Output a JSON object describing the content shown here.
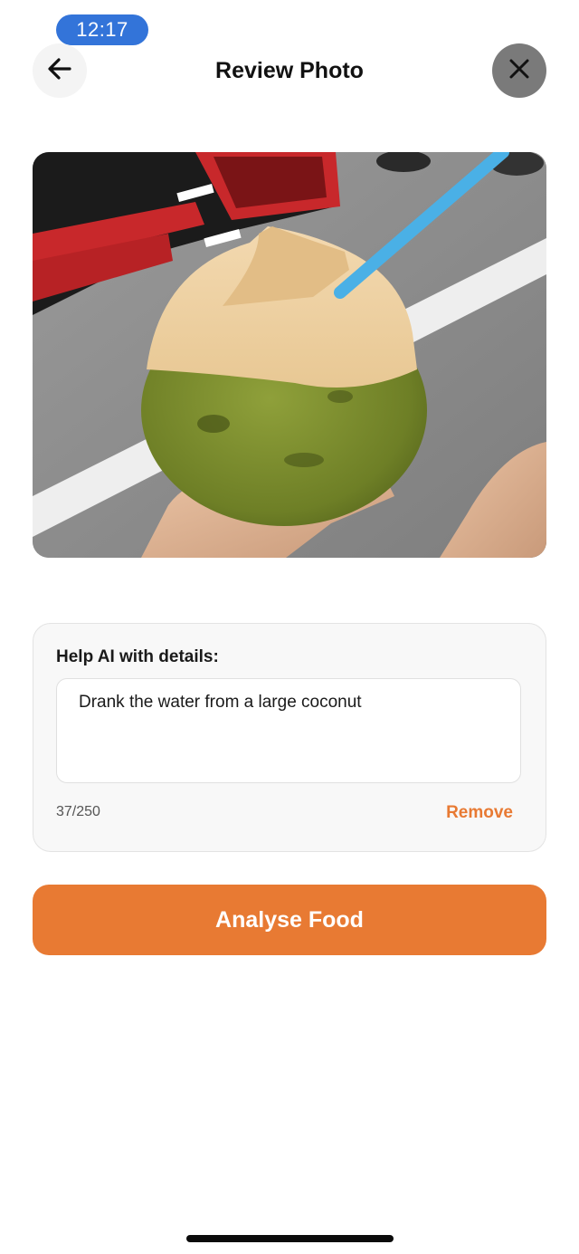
{
  "status_bar": {
    "time": "12:17"
  },
  "header": {
    "title": "Review Photo",
    "back_icon": "arrow-left-icon",
    "close_icon": "close-icon"
  },
  "photo": {
    "subject": "coconut-photo"
  },
  "details": {
    "label": "Help AI with details:",
    "value": "Drank the water from a large coconut",
    "char_count": "37/250",
    "remove_label": "Remove"
  },
  "actions": {
    "analyse_label": "Analyse Food"
  },
  "colors": {
    "accent": "#e87a33",
    "status_pill": "#3374d9",
    "close_button": "#7a7a7a"
  }
}
